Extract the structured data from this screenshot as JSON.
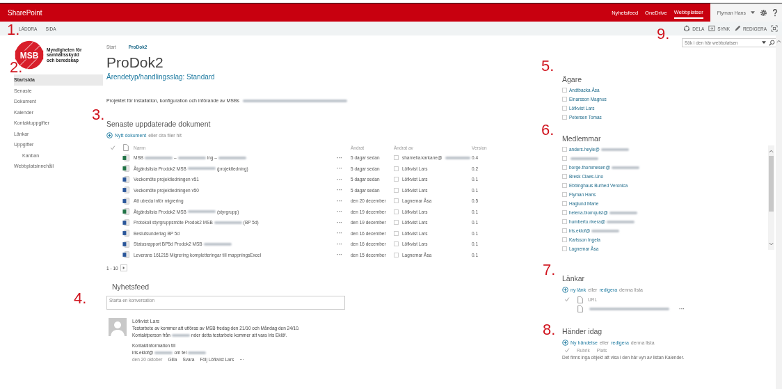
{
  "top_bar": {
    "brand": "SharePoint",
    "links": [
      {
        "label": "Nyhetsfeed",
        "selected": false
      },
      {
        "label": "OneDrive",
        "selected": false
      },
      {
        "label": "Webbplatser",
        "selected": true
      }
    ],
    "user": "Flyman Hans"
  },
  "ribbon": {
    "tabs": [
      "LÄDDRA",
      "SIDA"
    ],
    "actions": [
      {
        "label": "DELA",
        "kind": "share"
      },
      {
        "label": "SYNK",
        "kind": "sync"
      },
      {
        "label": "REDIGERA",
        "kind": "edit"
      }
    ]
  },
  "search": {
    "placeholder": "Sök i den här webbplatsen"
  },
  "logo": {
    "mark": "MSB",
    "org": [
      "Myndigheten för",
      "samhällsskydd",
      "och beredskap"
    ]
  },
  "breadcrumb": [
    "Start",
    "ProDok2"
  ],
  "title": "ProDok2",
  "nav": [
    {
      "label": "Startsida",
      "selected": true
    },
    {
      "label": "Senaste",
      "selected": false
    },
    {
      "label": "Dokument",
      "selected": false
    },
    {
      "label": "Kalender",
      "selected": false
    },
    {
      "label": "Kontaktuppgifter",
      "selected": false
    },
    {
      "label": "Länkar",
      "selected": false
    },
    {
      "label": "Uppgifter",
      "selected": false,
      "children": [
        {
          "label": "Kanban",
          "selected": false
        }
      ]
    },
    {
      "label": "Webbplatsinnehåll",
      "selected": false
    }
  ],
  "subtitle": "Ärendetyp/handlingsslag: Standard",
  "description": {
    "parts": [
      "Projektet för installation, konfiguration och införande av MSBs"
    ],
    "blur_end": true
  },
  "documents": {
    "heading": "Senaste uppdaterade dokument",
    "new": [
      {
        "text": "Nytt dokument",
        "link": true
      },
      {
        "text": "eller dra filer hit",
        "link": false
      }
    ],
    "columns": [
      "Namn",
      "Ändrat",
      "Ändrat av",
      "Version"
    ],
    "rows": [
      {
        "kind": "excel",
        "name": {
          "parts": [
            "MSB",
            "–",
            "ing –"
          ],
          "blur_end": true
        },
        "more": "···",
        "modified": "5 dagar sedan",
        "modified_by": {
          "parts": [
            "shamelia.karkane@"
          ],
          "blur_end": true
        },
        "version": "0.4"
      },
      {
        "kind": "excel",
        "name": {
          "parts": [
            "Åtgärdslista Prodok2 MSB",
            "(projektledning)"
          ],
          "blur_end": false
        },
        "more": "···",
        "modified": "5 dagar sedan",
        "modified_by": {
          "parts": [
            "Löfkvist Lars"
          ],
          "blur_end": false
        },
        "version": "0.2"
      },
      {
        "kind": "word",
        "name": {
          "parts": [
            "Veckomöte projektledningen v51"
          ],
          "blur_end": false
        },
        "more": "···",
        "modified": "5 dagar sedan",
        "modified_by": {
          "parts": [
            "Löfkvist Lars"
          ],
          "blur_end": false
        },
        "version": "0.1"
      },
      {
        "kind": "word",
        "name": {
          "parts": [
            "Veckomöte projektledningen v50"
          ],
          "blur_end": false
        },
        "more": "···",
        "modified": "5 dagar sedan",
        "modified_by": {
          "parts": [
            "Löfkvist Lars"
          ],
          "blur_end": false
        },
        "version": "0.1"
      },
      {
        "kind": "word",
        "name": {
          "parts": [
            "Att utreda inför migrering"
          ],
          "blur_end": false
        },
        "more": "···",
        "modified": "den 20 december",
        "modified_by": {
          "parts": [
            "Lagnemar Åsa"
          ],
          "blur_end": false
        },
        "version": "0.5"
      },
      {
        "kind": "excel",
        "name": {
          "parts": [
            "Åtgärdslista Prodok2 MSB",
            "(styrgrupp)"
          ],
          "blur_end": false
        },
        "more": "···",
        "modified": "den 19 december",
        "modified_by": {
          "parts": [
            "Löfkvist Lars"
          ],
          "blur_end": false
        },
        "version": "0.1"
      },
      {
        "kind": "word",
        "name": {
          "parts": [
            "Protokoll styrgruppsmöte Prodok2 MSB",
            "(BP 5d)"
          ],
          "blur_end": false
        },
        "more": "···",
        "modified": "den 19 december",
        "modified_by": {
          "parts": [
            "Löfkvist Lars"
          ],
          "blur_end": false
        },
        "version": "0.1"
      },
      {
        "kind": "word",
        "name": {
          "parts": [
            "Beslutsunderlag BP 5d"
          ],
          "blur_end": false
        },
        "more": "···",
        "modified": "den 16 december",
        "modified_by": {
          "parts": [
            "Löfkvist Lars"
          ],
          "blur_end": false
        },
        "version": "0.1"
      },
      {
        "kind": "word",
        "name": {
          "parts": [
            "Statusrapport BP5d Prodok2 MSB"
          ],
          "blur_end": true
        },
        "more": "···",
        "modified": "den 16 december",
        "modified_by": {
          "parts": [
            "Löfkvist Lars"
          ],
          "blur_end": false
        },
        "version": "0.1"
      },
      {
        "kind": "word",
        "name": {
          "parts": [
            "Leverans 161215 Migrering kompletteringar till mappningsExcel"
          ],
          "blur_end": false
        },
        "more": "···",
        "modified": "den 15 december",
        "modified_by": {
          "parts": [
            "Lagnemar Åsa"
          ],
          "blur_end": false
        },
        "version": "0.1"
      }
    ],
    "pager": "1 - 10"
  },
  "newsfeed": {
    "heading": "Nyhetsfeed",
    "placeholder": "Starta en konversation",
    "post": {
      "author": "Löfkvist Lars",
      "lines": [
        {
          "parts": [
            "Testarbete av kommer att utföras av MSB fredag den 21/10 och Måndag den 24/10."
          ],
          "blur_end": false
        },
        {
          "parts": [
            "Kontaktperson från",
            "nder detta testarbete kommer att vara Iris Eklöf."
          ],
          "blur_end": false
        }
      ],
      "contact": [
        {
          "parts": [
            "Kontaktinformation till"
          ],
          "blur_end": false
        },
        {
          "parts": [
            "iris.eklof@",
            "om  tel"
          ],
          "blur_end": true
        }
      ],
      "date": "den 20 oktober",
      "actions": [
        "Gilla",
        "Svara",
        "Följ Löfkvist Lars",
        "···"
      ]
    }
  },
  "owners": {
    "heading": "Ägare",
    "people": [
      "Andtbacka Åsa",
      "Einarsson Magnus",
      "Löfkvist Lars",
      "Petersen Tomas"
    ]
  },
  "members": {
    "heading": "Medlemmar",
    "people": [
      {
        "parts": [
          "anders.heyle@"
        ],
        "blur_end": true
      },
      {
        "blur_end": true
      },
      {
        "parts": [
          "borge.thommesen@"
        ],
        "blur_end": true
      },
      {
        "parts": [
          "Bresk Claes-Uno"
        ],
        "blur_end": false
      },
      {
        "parts": [
          "Ebbinghaus Burhed Veronica"
        ],
        "blur_end": false
      },
      {
        "parts": [
          "Flyman Hans"
        ],
        "blur_end": false
      },
      {
        "parts": [
          "Haglund Marie"
        ],
        "blur_end": false
      },
      {
        "parts": [
          "helena.blomquist@"
        ],
        "blur_end": true
      },
      {
        "parts": [
          "humberto.rivera@"
        ],
        "blur_end": true
      },
      {
        "parts": [
          "iris.eklof@"
        ],
        "blur_end": true
      },
      {
        "parts": [
          "Karlsson Ingela"
        ],
        "blur_end": false
      },
      {
        "parts": [
          "Lagnemar Åsa"
        ],
        "blur_end": false
      }
    ]
  },
  "links": {
    "heading": "Länkar",
    "new": [
      {
        "text": "ny länk",
        "link": true
      },
      {
        "text": "eller",
        "link": false
      },
      {
        "text": "redigera",
        "link": true
      },
      {
        "text": "denna lista",
        "link": false
      }
    ],
    "columns": [
      "URL"
    ],
    "rows": [
      {
        "more": "···"
      }
    ]
  },
  "events": {
    "heading": "Händer idag",
    "new": [
      {
        "text": "Ny händelse",
        "link": true
      },
      {
        "text": "eller",
        "link": false
      },
      {
        "text": "redigera",
        "link": true
      },
      {
        "text": "denna lista",
        "link": false
      }
    ],
    "columns": [
      "Rubrik",
      "Plats"
    ],
    "empty": "Det finns inga objekt att visa i den här vyn av listan Kalender."
  },
  "annotations": [
    "1.",
    "2.",
    "3.",
    "4.",
    "5.",
    "6.",
    "7.",
    "8.",
    "9."
  ]
}
